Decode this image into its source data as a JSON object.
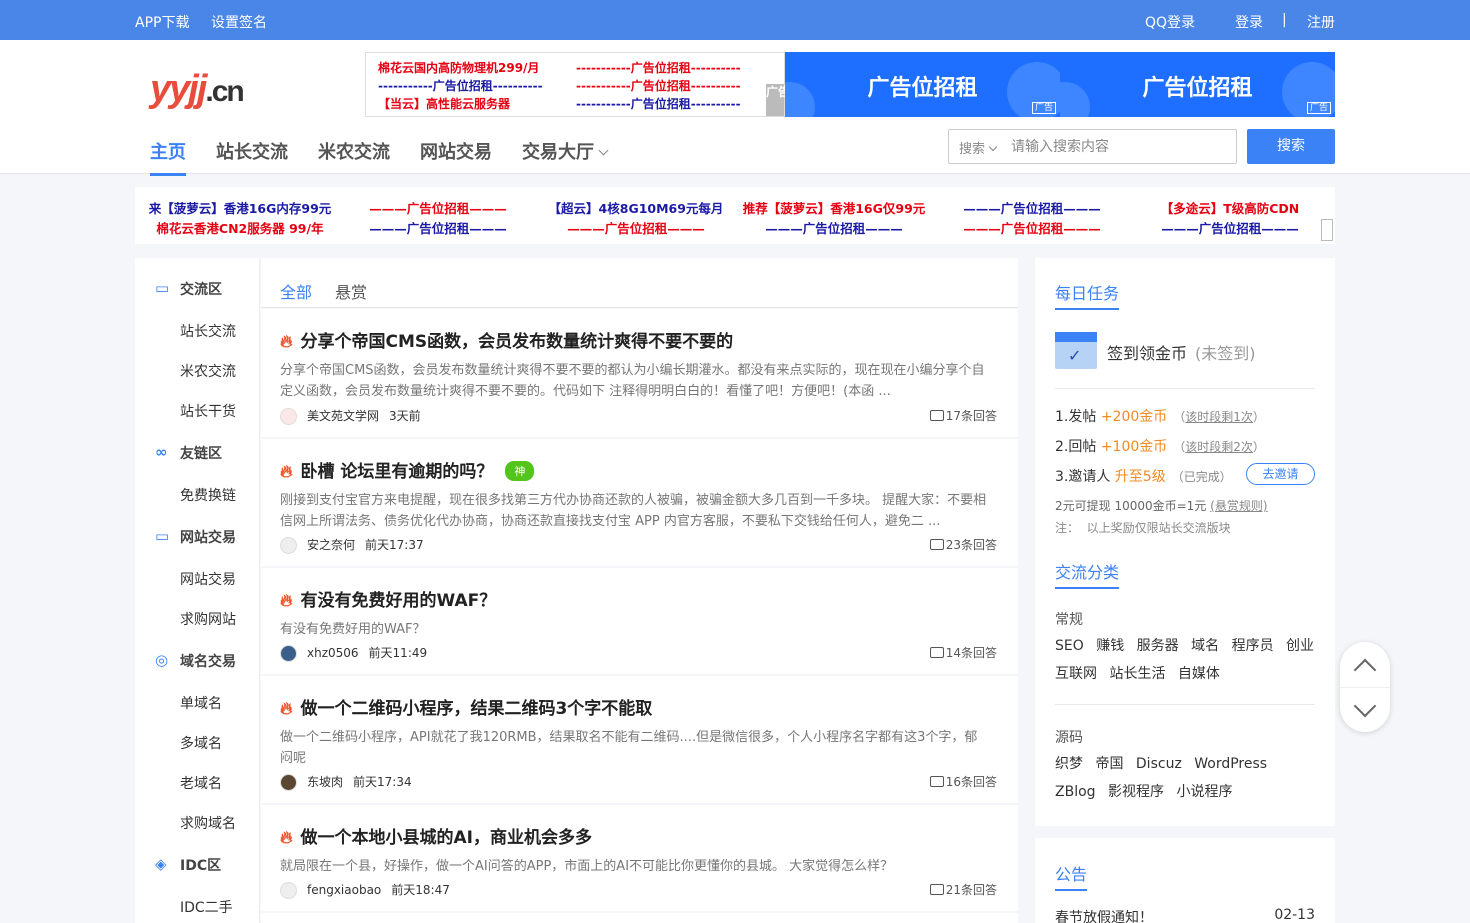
{
  "topbar": {
    "app_download": "APP下载",
    "set_signature": "设置签名",
    "qq_login": "QQ登录",
    "login": "登录",
    "divider": "|",
    "register": "注册"
  },
  "logo": {
    "part1": "yyjj",
    "part2": ".cn"
  },
  "header_ads": {
    "text_ads": [
      "棉花云国内高防物理机299/月",
      "-----------广告位招租----------",
      "-----------广告位招租----------",
      "-----------广告位招租----------",
      "【当云】高性能云服务器",
      "-----------广告位招租----------"
    ],
    "ad_tag": "广告",
    "banners": [
      "广告位招租",
      "广告位招租"
    ],
    "banner_tag": "广告"
  },
  "nav": {
    "items": [
      "主页",
      "站长交流",
      "米农交流",
      "网站交易",
      "交易大厅"
    ]
  },
  "search": {
    "scope": "搜索",
    "placeholder": "请输入搜索内容",
    "button": "搜索"
  },
  "ad_strip": {
    "row1": [
      "来【菠萝云】香港16G内存99元",
      "———广告位招租———",
      "【超云】4核8G10M69元每月",
      "推荐【菠萝云】香港16G仅99元",
      "———广告位招租———",
      "【多途云】T级高防CDN"
    ],
    "row2": [
      "棉花云香港CN2服务器 99/年",
      "———广告位招租———",
      "———广告位招租———",
      "———广告位招租———",
      "———广告位招租———",
      "———广告位招租———"
    ],
    "tag": "广告"
  },
  "sidebar": {
    "sections": [
      {
        "title": "交流区",
        "items": [
          "站长交流",
          "米农交流",
          "站长干货"
        ]
      },
      {
        "title": "友链区",
        "items": [
          "免费换链"
        ]
      },
      {
        "title": "网站交易",
        "items": [
          "网站交易",
          "求购网站"
        ]
      },
      {
        "title": "域名交易",
        "items": [
          "单域名",
          "多域名",
          "老域名",
          "求购域名"
        ]
      },
      {
        "title": "IDC区",
        "items": [
          "IDC二手"
        ]
      }
    ]
  },
  "tabs": [
    "全部",
    "悬赏"
  ],
  "posts": [
    {
      "title": "分享个帝国CMS函数，会员发布数量统计爽得不要不要的",
      "excerpt": "分享个帝国CMS函数，会员发布数量统计爽得不要不要的都认为小编长期灌水。都没有来点实际的，现在现在小编分享个自定义函数，会员发布数量统计爽得不要不要的。代码如下 注释得明明白白的！看懂了吧！方便吧！(本函 ...",
      "author": "美文苑文学网",
      "time": "3天前",
      "replies": "17条回答"
    },
    {
      "title": "卧槽 论坛里有逾期的吗？",
      "badge": "神",
      "excerpt": "刚接到支付宝官方来电提醒，现在很多找第三方代办协商还款的人被骗，被骗金额大多几百到一千多块。 提醒大家：不要相信网上所谓法务、债务优化代办协商，协商还款直接找支付宝 APP 内官方客服，不要私下交钱给任何人，避免二 ...",
      "author": "安之奈何",
      "time": "前天17:37",
      "replies": "23条回答"
    },
    {
      "title": "有没有免费好用的WAF？",
      "excerpt": "有没有免费好用的WAF？",
      "author": "xhz0506",
      "time": "前天11:49",
      "replies": "14条回答"
    },
    {
      "title": "做一个二维码小程序，结果二维码3个字不能取",
      "excerpt": "做一个二维码小程序，API就花了我120RMB，结果取名不能有二维码....但是微信很多，个人小程序名字都有这3个字，郁闷呢",
      "author": "东坡肉",
      "time": "前天17:34",
      "replies": "16条回答"
    },
    {
      "title": "做一个本地小县城的AI，商业机会多多",
      "excerpt": "就局限在一个县，好操作，做一个AI问答的APP，市面上的AI不可能比你更懂你的县城。 大家觉得怎么样？",
      "author": "fengxiaobao",
      "time": "前天18:47",
      "replies": "21条回答"
    }
  ],
  "daily": {
    "title": "每日任务",
    "signin": "签到领金币",
    "signin_status": "(未签到)",
    "tasks": [
      {
        "label": "1.发帖",
        "reward": "+200金币",
        "left": "（",
        "hint": "该时段剩1次",
        "right": "）"
      },
      {
        "label": "2.回帖",
        "reward": "+100金币",
        "left": "（",
        "hint": "该时段剩2次",
        "right": "）"
      },
      {
        "label": "3.邀请人",
        "reward": "升至5级",
        "left": "",
        "hint": "（已完成）",
        "right": ""
      }
    ],
    "invite_button": "去邀请",
    "withdraw": "2元可提现 10000金币=1元",
    "rules": "(悬赏规则)",
    "note_label": "注：",
    "note": "以上奖励仅限站长交流版块"
  },
  "categories": {
    "title": "交流分类",
    "groups": [
      {
        "label": "常规",
        "tags": [
          "SEO",
          "赚钱",
          "服务器",
          "域名",
          "程序员",
          "创业",
          "互联网",
          "站长生活",
          "自媒体"
        ]
      },
      {
        "label": "源码",
        "tags": [
          "织梦",
          "帝国",
          "Discuz",
          "WordPress",
          "ZBlog",
          "影视程序",
          "小说程序"
        ]
      }
    ]
  },
  "notice": {
    "title": "公告",
    "items": [
      {
        "text": "春节放假通知！",
        "date": "02-13"
      }
    ]
  },
  "colors": {
    "primary": "#3b82f6",
    "topbar": "#4a86e8",
    "ad_red": "#e60012",
    "ad_blue": "#1a1aa6",
    "orange": "#f08a24"
  }
}
